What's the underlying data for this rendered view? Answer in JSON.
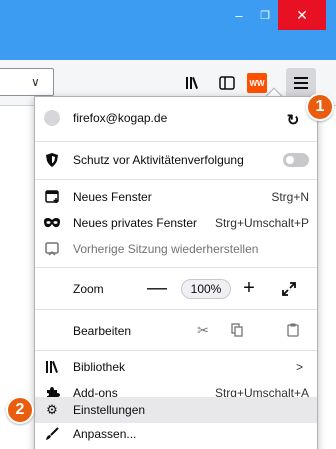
{
  "window": {
    "minimize_glyph": "–",
    "maximize_glyph": "❐",
    "close_glyph": "✕"
  },
  "toolbar": {
    "dropmarker_glyph": "∨",
    "extension_badge_text": "WW"
  },
  "menu": {
    "account": {
      "email": "firefox@kogap.de"
    },
    "tracking": {
      "label": "Schutz vor Aktivitätenverfolgung"
    },
    "items_window": [
      {
        "label": "Neues Fenster",
        "shortcut": "Strg+N"
      },
      {
        "label": "Neues privates Fenster",
        "shortcut": "Strg+Umschalt+P"
      },
      {
        "label": "Vorherige Sitzung wiederherstellen",
        "shortcut": ""
      }
    ],
    "zoom": {
      "label": "Zoom",
      "minus": "—",
      "value": "100%",
      "plus": "+"
    },
    "edit": {
      "label": "Bearbeiten"
    },
    "library": {
      "label": "Bibliothek",
      "chevron": ">"
    },
    "addons": {
      "label": "Add-ons",
      "shortcut": "Strg+Umschalt+A"
    },
    "settings": {
      "label": "Einstellungen"
    },
    "customize": {
      "label": "Anpassen..."
    }
  },
  "callouts": {
    "one": "1",
    "two": "2"
  },
  "colors": {
    "titlebar": "#3b9cf1",
    "close": "#e81123",
    "badge": "#e85d0e"
  }
}
